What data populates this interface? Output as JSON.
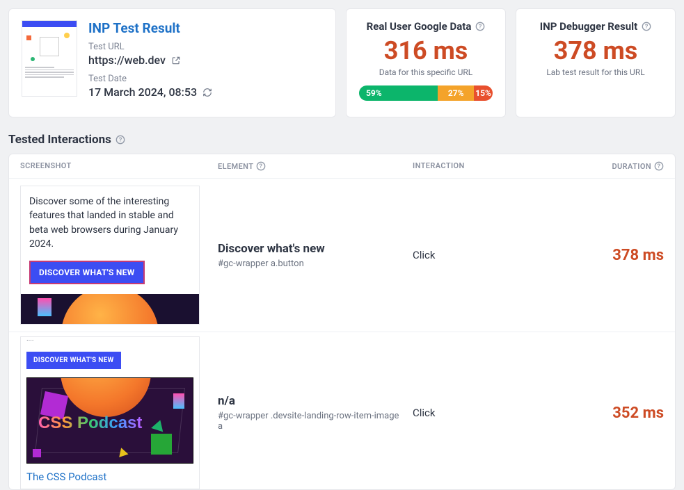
{
  "header": {
    "title": "INP Test Result",
    "url_label": "Test URL",
    "url_value": "https://web.dev",
    "date_label": "Test Date",
    "date_value": "17 March 2024, 08:53"
  },
  "google_card": {
    "title": "Real User Google Data",
    "value": "316 ms",
    "caption": "Data for this specific URL",
    "distribution": {
      "good": "59%",
      "ni": "27%",
      "poor": "15%"
    }
  },
  "debug_card": {
    "title": "INP Debugger Result",
    "value": "378 ms",
    "caption": "Lab test result for this URL"
  },
  "section_title": "Tested Interactions",
  "columns": {
    "screenshot": "SCREENSHOT",
    "element": "ELEMENT",
    "interaction": "INTERACTION",
    "duration": "DURATION"
  },
  "rows": [
    {
      "screenshot": {
        "text": "Discover some of the interesting features that landed in stable and beta web browsers during January 2024.",
        "button": "DISCOVER WHAT'S NEW"
      },
      "element_name": "Discover what's new",
      "element_selector": "#gc-wrapper a.button",
      "interaction": "Click",
      "duration": "378 ms"
    },
    {
      "screenshot": {
        "button": "DISCOVER WHAT'S NEW",
        "media_title": "CSS Podcast",
        "link": "The CSS Podcast"
      },
      "element_name": "n/a",
      "element_selector": "#gc-wrapper .devsite-landing-row-item-image a",
      "interaction": "Click",
      "duration": "352 ms"
    }
  ]
}
